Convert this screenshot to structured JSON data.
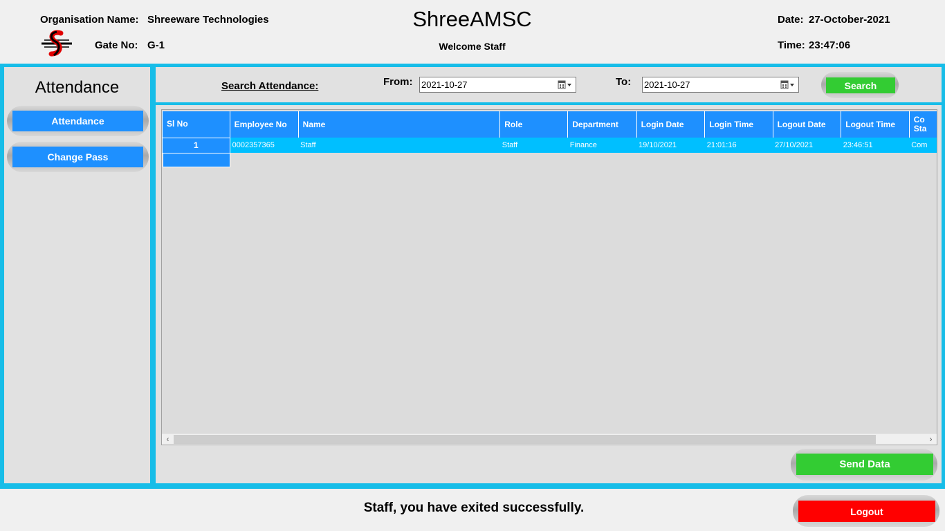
{
  "header": {
    "org_label": "Organisation Name:",
    "org_value": "Shreeware Technologies",
    "gate_label": "Gate No:",
    "gate_value": "G-1",
    "app_title": "ShreeAMSC",
    "welcome": "Welcome Staff",
    "date_label": "Date:",
    "date_value": "27-October-2021",
    "time_label": "Time:",
    "time_value": "23:47:06"
  },
  "sidebar": {
    "title": "Attendance",
    "items": [
      {
        "label": "Attendance"
      },
      {
        "label": "Change Pass"
      }
    ]
  },
  "search": {
    "title": "Search Attendance:",
    "from_label": "From:",
    "from_value": "2021-10-27",
    "to_label": "To:",
    "to_value": "2021-10-27",
    "button": "Search"
  },
  "table": {
    "columns": [
      "Sl No",
      "Employee No",
      "Name",
      "Role",
      "Department",
      "Login Date",
      "Login Time",
      "Logout Date",
      "Logout Time",
      "Co Sta"
    ],
    "rows": [
      [
        "1",
        "0002357365",
        "Staff",
        "Staff",
        "Finance",
        "19/10/2021",
        "21:01:16",
        "27/10/2021",
        "23:46:51",
        "Com"
      ]
    ]
  },
  "actions": {
    "send_data": "Send Data",
    "logout": "Logout"
  },
  "footer": {
    "message": "Staff, you have exited successfully."
  },
  "colors": {
    "frame": "#17bde8",
    "header_blue": "#1e90ff",
    "row_cyan": "#00bfff",
    "green": "#33cc33",
    "red": "#ff0000"
  },
  "scrollbar": {
    "left_arrow": "‹",
    "right_arrow": "›"
  }
}
